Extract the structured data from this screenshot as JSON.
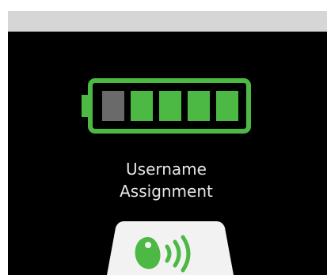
{
  "status_bar": {},
  "battery": {
    "level_fraction": 0.8,
    "total_segments": 5,
    "filled_segments": 4,
    "fill_color": "#4cb944",
    "empty_color": "#6a6a6a",
    "frame_color": "#4cb944"
  },
  "caption": {
    "line1": "Username",
    "line2": "Assignment"
  },
  "nfc_button": {
    "icon": "nfc-tag-icon",
    "accent_color": "#4cb944",
    "background_color": "#f2f2f2"
  }
}
